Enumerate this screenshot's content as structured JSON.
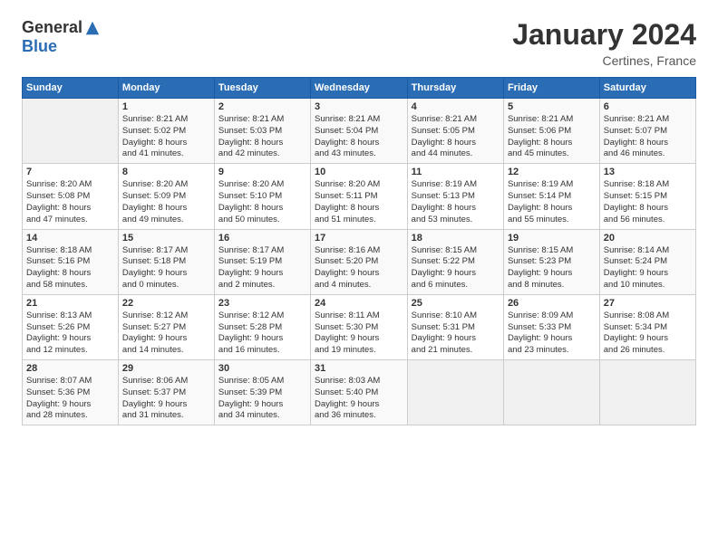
{
  "logo": {
    "general": "General",
    "blue": "Blue"
  },
  "header": {
    "month": "January 2024",
    "location": "Certines, France"
  },
  "days_of_week": [
    "Sunday",
    "Monday",
    "Tuesday",
    "Wednesday",
    "Thursday",
    "Friday",
    "Saturday"
  ],
  "weeks": [
    [
      {
        "day": "",
        "info": ""
      },
      {
        "day": "1",
        "info": "Sunrise: 8:21 AM\nSunset: 5:02 PM\nDaylight: 8 hours\nand 41 minutes."
      },
      {
        "day": "2",
        "info": "Sunrise: 8:21 AM\nSunset: 5:03 PM\nDaylight: 8 hours\nand 42 minutes."
      },
      {
        "day": "3",
        "info": "Sunrise: 8:21 AM\nSunset: 5:04 PM\nDaylight: 8 hours\nand 43 minutes."
      },
      {
        "day": "4",
        "info": "Sunrise: 8:21 AM\nSunset: 5:05 PM\nDaylight: 8 hours\nand 44 minutes."
      },
      {
        "day": "5",
        "info": "Sunrise: 8:21 AM\nSunset: 5:06 PM\nDaylight: 8 hours\nand 45 minutes."
      },
      {
        "day": "6",
        "info": "Sunrise: 8:21 AM\nSunset: 5:07 PM\nDaylight: 8 hours\nand 46 minutes."
      }
    ],
    [
      {
        "day": "7",
        "info": "Sunrise: 8:20 AM\nSunset: 5:08 PM\nDaylight: 8 hours\nand 47 minutes."
      },
      {
        "day": "8",
        "info": "Sunrise: 8:20 AM\nSunset: 5:09 PM\nDaylight: 8 hours\nand 49 minutes."
      },
      {
        "day": "9",
        "info": "Sunrise: 8:20 AM\nSunset: 5:10 PM\nDaylight: 8 hours\nand 50 minutes."
      },
      {
        "day": "10",
        "info": "Sunrise: 8:20 AM\nSunset: 5:11 PM\nDaylight: 8 hours\nand 51 minutes."
      },
      {
        "day": "11",
        "info": "Sunrise: 8:19 AM\nSunset: 5:13 PM\nDaylight: 8 hours\nand 53 minutes."
      },
      {
        "day": "12",
        "info": "Sunrise: 8:19 AM\nSunset: 5:14 PM\nDaylight: 8 hours\nand 55 minutes."
      },
      {
        "day": "13",
        "info": "Sunrise: 8:18 AM\nSunset: 5:15 PM\nDaylight: 8 hours\nand 56 minutes."
      }
    ],
    [
      {
        "day": "14",
        "info": "Sunrise: 8:18 AM\nSunset: 5:16 PM\nDaylight: 8 hours\nand 58 minutes."
      },
      {
        "day": "15",
        "info": "Sunrise: 8:17 AM\nSunset: 5:18 PM\nDaylight: 9 hours\nand 0 minutes."
      },
      {
        "day": "16",
        "info": "Sunrise: 8:17 AM\nSunset: 5:19 PM\nDaylight: 9 hours\nand 2 minutes."
      },
      {
        "day": "17",
        "info": "Sunrise: 8:16 AM\nSunset: 5:20 PM\nDaylight: 9 hours\nand 4 minutes."
      },
      {
        "day": "18",
        "info": "Sunrise: 8:15 AM\nSunset: 5:22 PM\nDaylight: 9 hours\nand 6 minutes."
      },
      {
        "day": "19",
        "info": "Sunrise: 8:15 AM\nSunset: 5:23 PM\nDaylight: 9 hours\nand 8 minutes."
      },
      {
        "day": "20",
        "info": "Sunrise: 8:14 AM\nSunset: 5:24 PM\nDaylight: 9 hours\nand 10 minutes."
      }
    ],
    [
      {
        "day": "21",
        "info": "Sunrise: 8:13 AM\nSunset: 5:26 PM\nDaylight: 9 hours\nand 12 minutes."
      },
      {
        "day": "22",
        "info": "Sunrise: 8:12 AM\nSunset: 5:27 PM\nDaylight: 9 hours\nand 14 minutes."
      },
      {
        "day": "23",
        "info": "Sunrise: 8:12 AM\nSunset: 5:28 PM\nDaylight: 9 hours\nand 16 minutes."
      },
      {
        "day": "24",
        "info": "Sunrise: 8:11 AM\nSunset: 5:30 PM\nDaylight: 9 hours\nand 19 minutes."
      },
      {
        "day": "25",
        "info": "Sunrise: 8:10 AM\nSunset: 5:31 PM\nDaylight: 9 hours\nand 21 minutes."
      },
      {
        "day": "26",
        "info": "Sunrise: 8:09 AM\nSunset: 5:33 PM\nDaylight: 9 hours\nand 23 minutes."
      },
      {
        "day": "27",
        "info": "Sunrise: 8:08 AM\nSunset: 5:34 PM\nDaylight: 9 hours\nand 26 minutes."
      }
    ],
    [
      {
        "day": "28",
        "info": "Sunrise: 8:07 AM\nSunset: 5:36 PM\nDaylight: 9 hours\nand 28 minutes."
      },
      {
        "day": "29",
        "info": "Sunrise: 8:06 AM\nSunset: 5:37 PM\nDaylight: 9 hours\nand 31 minutes."
      },
      {
        "day": "30",
        "info": "Sunrise: 8:05 AM\nSunset: 5:39 PM\nDaylight: 9 hours\nand 34 minutes."
      },
      {
        "day": "31",
        "info": "Sunrise: 8:03 AM\nSunset: 5:40 PM\nDaylight: 9 hours\nand 36 minutes."
      },
      {
        "day": "",
        "info": ""
      },
      {
        "day": "",
        "info": ""
      },
      {
        "day": "",
        "info": ""
      }
    ]
  ]
}
